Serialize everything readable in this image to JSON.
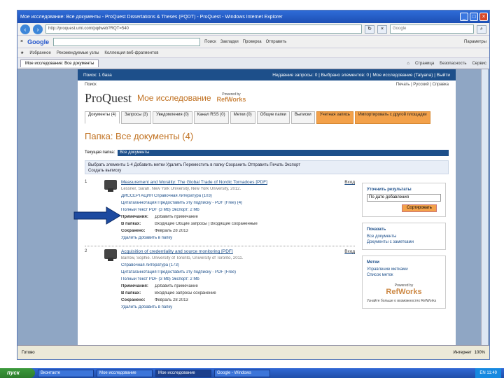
{
  "window": {
    "title": "Мое исследование: Все документы - ProQuest Dissertations & Theses (PQDT) - ProQuest - Windows Internet Explorer"
  },
  "browser": {
    "address": "http://proquest.umi.com/pqdweb?RQT=540",
    "search_placeholder": "Google",
    "google_label": "Google",
    "google_items": [
      "Поиск",
      "Закладки",
      "Проверка",
      "Отправить",
      "Параметры"
    ],
    "favorites": [
      "Избранное",
      "Рекомендуемые узлы",
      "Коллекция веб-фрагментов"
    ],
    "tab": "Мое исследование: Все документы",
    "tab_right": [
      "Страница",
      "Безопасность",
      "Сервис"
    ]
  },
  "pq": {
    "topnav_left": "Поиск: 1 база",
    "topnav_right": "Недавние запросы: 0 | Выбрано элементов: 0 | Мое исследование (Tatyana) | Выйти",
    "help_left": "Поиск",
    "help_right": "Печать | Русский | Справка",
    "logo": "ProQuest",
    "my_research": "Мое исследование",
    "powered": "Powered by",
    "refworks": "RefWorks",
    "tabs": [
      "Документы (4)",
      "Запросы (3)",
      "Уведомления (0)",
      "Канал RSS (0)",
      "Метки (0)",
      "Общие папки",
      "Выписки",
      "Учетная запись",
      "Импортировать с другой площадки"
    ],
    "folder_title": "Папка: Все документы (4)",
    "folder_label": "Текущая папка:",
    "folder_value": "Все документы",
    "actions1": "Выбрать элементы 1-4   Добавить метки   Удалить   Переместить в папку   Сохранить   Отправить   Печать   Экспорт",
    "actions2": "Создать выписку",
    "items": [
      {
        "num": "1",
        "title": "Measurement and Morality: The Global Trade of Nordic Tornadoes [PDF]",
        "inbox": "Вход",
        "meta": "Lessner, Sarah. New York University, New York University, 2012.",
        "line2": "ДИССЕРТАЦИЯ   Справочная литература (103)",
        "line3": "Цитата/аннотация   Предоставить эту подписку - PDF (Free) (4)",
        "line4": "Полный текст   PDF (3 Mb)   Экспорт: 2 Mb",
        "notes_label": "Примечания:",
        "notes_val": "Добавить примечание",
        "folders_label": "В папках:",
        "folders_val": "Входящие    Общие запросы | Входящие сохраненные",
        "saved_label": "Сохранено:",
        "saved_val": "Февраль 28 2013",
        "delete": "Удалить",
        "add_folder": "Добавить в папку"
      },
      {
        "num": "2",
        "title": "Acquisition of credentiality and source monitoring [PDF]",
        "inbox": "Вход",
        "meta": "Barrow, Sophie. University of Toronto, University of Toronto, 2011.",
        "line2": "Справочная литература (173)",
        "line3": "Цитата/аннотация   Предоставить эту подписку - PDF (Free)",
        "line4": "Полный текст   PDF (3 Mb)   Экспорт: 2 Mb",
        "notes_label": "Примечания:",
        "notes_val": "Добавить примечание",
        "folders_label": "В папках:",
        "folders_val": "Входящие запросы сохранение",
        "saved_label": "Сохранено:",
        "saved_val": "Февраль 28 2013",
        "delete": "Удалить",
        "add_folder": "Добавить в папку"
      }
    ],
    "side": {
      "filter_head": "Уточнить результаты",
      "filter_value": "По дате добавления",
      "sort_btn": "Сортировать",
      "folder_head": "Показать",
      "folder_links": [
        "Все документы",
        "Документы с заметками"
      ],
      "tag_head": "Метки",
      "tag_links": [
        "Управление метками",
        "Список меток"
      ],
      "rw_powered": "Powered by",
      "rw_name": "RefWorks",
      "foot": "Узнайте больше о возможностях RefWorks"
    }
  },
  "status": {
    "left": "Готово",
    "right": "Интернет",
    "zoom": "100%"
  },
  "taskbar": {
    "start": "пуск",
    "tasks": [
      "Вконтакте",
      "Мое исследование",
      "Мое исследование",
      "Google - Windows"
    ],
    "tray": "EN 11:49"
  }
}
